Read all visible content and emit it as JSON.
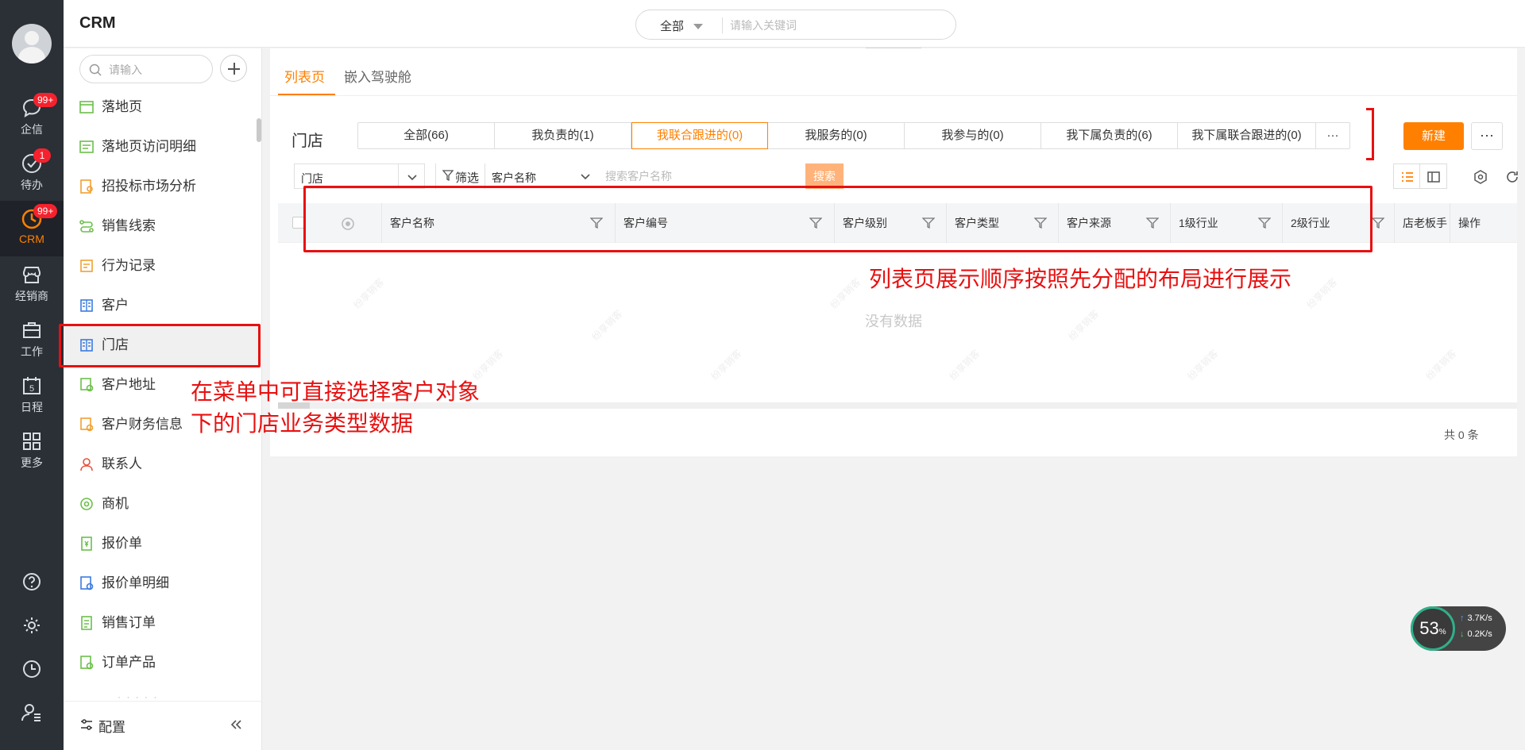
{
  "app": {
    "title": "CRM"
  },
  "rail": {
    "items": [
      {
        "label": "企信",
        "badge": "99+"
      },
      {
        "label": "待办",
        "badge": "1"
      },
      {
        "label": "CRM",
        "badge": "99+"
      },
      {
        "label": "经销商"
      },
      {
        "label": "工作"
      },
      {
        "label": "日程",
        "day": "5"
      },
      {
        "label": "更多"
      }
    ]
  },
  "global_search": {
    "scope": "全部",
    "placeholder": "请输入关键词"
  },
  "sidebar": {
    "search_placeholder": "请输入",
    "items": [
      {
        "label": "落地页",
        "icon": "landing-page-icon"
      },
      {
        "label": "落地页访问明细",
        "icon": "landing-visit-icon"
      },
      {
        "label": "招投标市场分析",
        "icon": "bidding-analysis-icon"
      },
      {
        "label": "销售线索",
        "icon": "sales-lead-icon"
      },
      {
        "label": "行为记录",
        "icon": "behavior-record-icon"
      },
      {
        "label": "客户",
        "icon": "customer-icon"
      },
      {
        "label": "门店",
        "icon": "store-icon"
      },
      {
        "label": "客户地址",
        "icon": "customer-address-icon"
      },
      {
        "label": "客户财务信息",
        "icon": "customer-finance-icon"
      },
      {
        "label": "联系人",
        "icon": "contact-icon"
      },
      {
        "label": "商机",
        "icon": "opportunity-icon"
      },
      {
        "label": "报价单",
        "icon": "quote-icon"
      },
      {
        "label": "报价单明细",
        "icon": "quote-detail-icon"
      },
      {
        "label": "销售订单",
        "icon": "sales-order-icon"
      },
      {
        "label": "订单产品",
        "icon": "order-product-icon"
      }
    ],
    "config_label": "配置"
  },
  "main": {
    "tabs": [
      {
        "label": "列表页",
        "active": true
      },
      {
        "label": "嵌入驾驶舱"
      }
    ],
    "object_title": "门店",
    "scenes": [
      {
        "label": "全部(66)"
      },
      {
        "label": "我负责的(1)"
      },
      {
        "label": "我联合跟进的(0)",
        "active": true
      },
      {
        "label": "我服务的(0)"
      },
      {
        "label": "我参与的(0)"
      },
      {
        "label": "我下属负责的(6)"
      },
      {
        "label": "我下属联合跟进的(0)"
      },
      {
        "label": "···"
      }
    ],
    "new_label": "新建",
    "more_label": "···",
    "filter": {
      "type_value": "门店",
      "filter_label": "筛选",
      "field_value": "客户名称",
      "keyword_placeholder": "搜索客户名称",
      "search_label": "搜索"
    },
    "columns": [
      "客户名称",
      "客户编号",
      "客户级别",
      "客户类型",
      "客户来源",
      "1级行业",
      "2级行业",
      "店老板手",
      "操作"
    ],
    "empty_text": "没有数据",
    "total_text": "共 0 条",
    "watermark": "纷享销客"
  },
  "annotations": {
    "menu_note_line1": "在菜单中可直接选择客户对象",
    "menu_note_line2": "下的门店业务类型数据",
    "list_note": "列表页展示顺序按照先分配的布局进行展示"
  },
  "speed_widget": {
    "percent": "53",
    "unit": "%",
    "up": "3.7",
    "down": "0.2",
    "rate_unit": "K/s"
  },
  "colors": {
    "accent": "#ff8000",
    "rail_bg": "#2b2f36",
    "annotation": "#e81010",
    "badge": "#f5222d"
  }
}
